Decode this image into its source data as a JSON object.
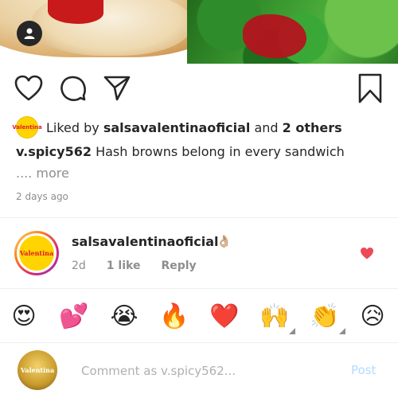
{
  "post": {
    "liked_by_prefix": "Liked by",
    "liked_by_user": "salsavalentinaoficial",
    "liked_by_suffix": "and",
    "liked_by_others": "2 others",
    "liked_avatar_text": "Valentina",
    "caption_user": "v.spicy562",
    "caption_text": "Hash browns belong in every sandwich",
    "more_label": ".... more",
    "time_ago": "2 days ago"
  },
  "icons": {
    "like": "heart-outline-icon",
    "comment": "comment-bubble-icon",
    "share": "paper-plane-icon",
    "save": "bookmark-icon",
    "user_tag": "person-icon"
  },
  "comment": {
    "user": "salsavalentinaoficial",
    "emoji": "👌🏼",
    "avatar_text": "Valentina",
    "time": "2d",
    "likes": "1 like",
    "reply_label": "Reply",
    "heart_color": "#ed4956"
  },
  "emoji_bar": [
    {
      "char": "😍",
      "name": "heart-eyes"
    },
    {
      "char": "💕",
      "name": "two-hearts"
    },
    {
      "char": "😭",
      "name": "loudly-crying"
    },
    {
      "char": "🔥",
      "name": "fire"
    },
    {
      "char": "❤️",
      "name": "red-heart"
    },
    {
      "char": "🙌",
      "name": "raising-hands"
    },
    {
      "char": "👏",
      "name": "clapping-hands"
    },
    {
      "char": "😥",
      "name": "sad-relieved"
    }
  ],
  "composer": {
    "placeholder": "Comment as v.spicy562...",
    "avatar_text": "Valentina",
    "post_label": "Post",
    "post_color": "#b3dbff"
  }
}
